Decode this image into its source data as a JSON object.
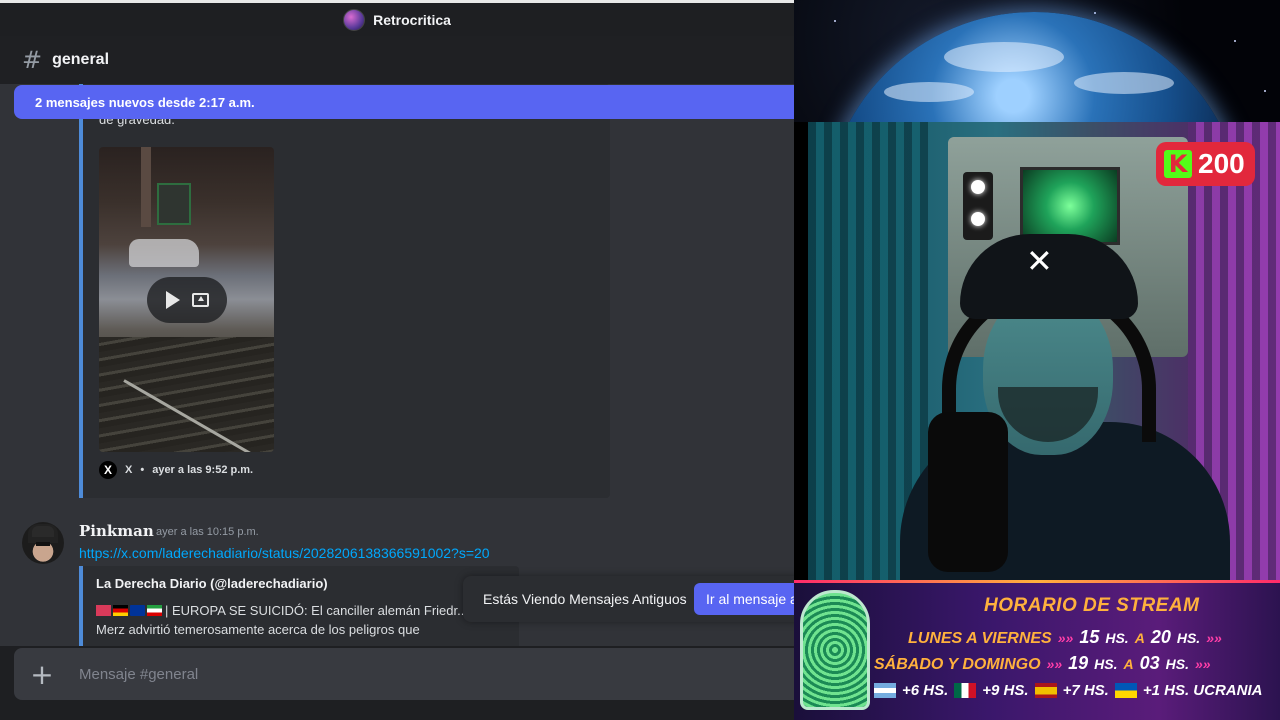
{
  "window": {
    "title": "Retrocritica"
  },
  "channel": {
    "name": "general"
  },
  "new_messages_banner": "2 mensajes nuevos desde 2:17 a.m.",
  "embed1": {
    "cut_text": "de gravedad.",
    "footer_source": "X",
    "footer_time": "ayer a las 9:52 p.m."
  },
  "message2": {
    "username": "Pinkman",
    "timestamp": "ayer a las 10:15 p.m.",
    "link": "https://x.com/laderechadiario/status/2028206138366591002?s=20",
    "embed": {
      "author": "La Derecha Diario (@laderechadiario)",
      "text_line1": "| EUROPA SE SUICIDÓ: El canciller alemán Friedr...",
      "text_line2": "Merz advirtió temerosamente acerca de los peligros que"
    }
  },
  "old_messages_toast": {
    "text": "Estás Viendo Mensajes Antiguos",
    "button": "Ir al mensaje a"
  },
  "composer": {
    "placeholder": "Mensaje #general"
  },
  "stream": {
    "kudos_count": "200",
    "schedule": {
      "title": "HORARIO DE STREAM",
      "row1_days": "LUNES A VIERNES",
      "row1_start": "15",
      "row1_end": "20",
      "row2_days": "SÁBADO Y DOMINGO",
      "row2_start": "19",
      "row2_end": "03",
      "hs_label": "HS.",
      "a_label": "A",
      "tz1": "+6 HS.",
      "tz2": "+9 HS.",
      "tz3": "+7 HS.",
      "tz4": "+1 HS. UCRANIA"
    }
  },
  "colors": {
    "accent": "#5865f2",
    "link": "#00a8fc",
    "kick_green": "#53fc18",
    "kudos_red": "#e2283c"
  }
}
